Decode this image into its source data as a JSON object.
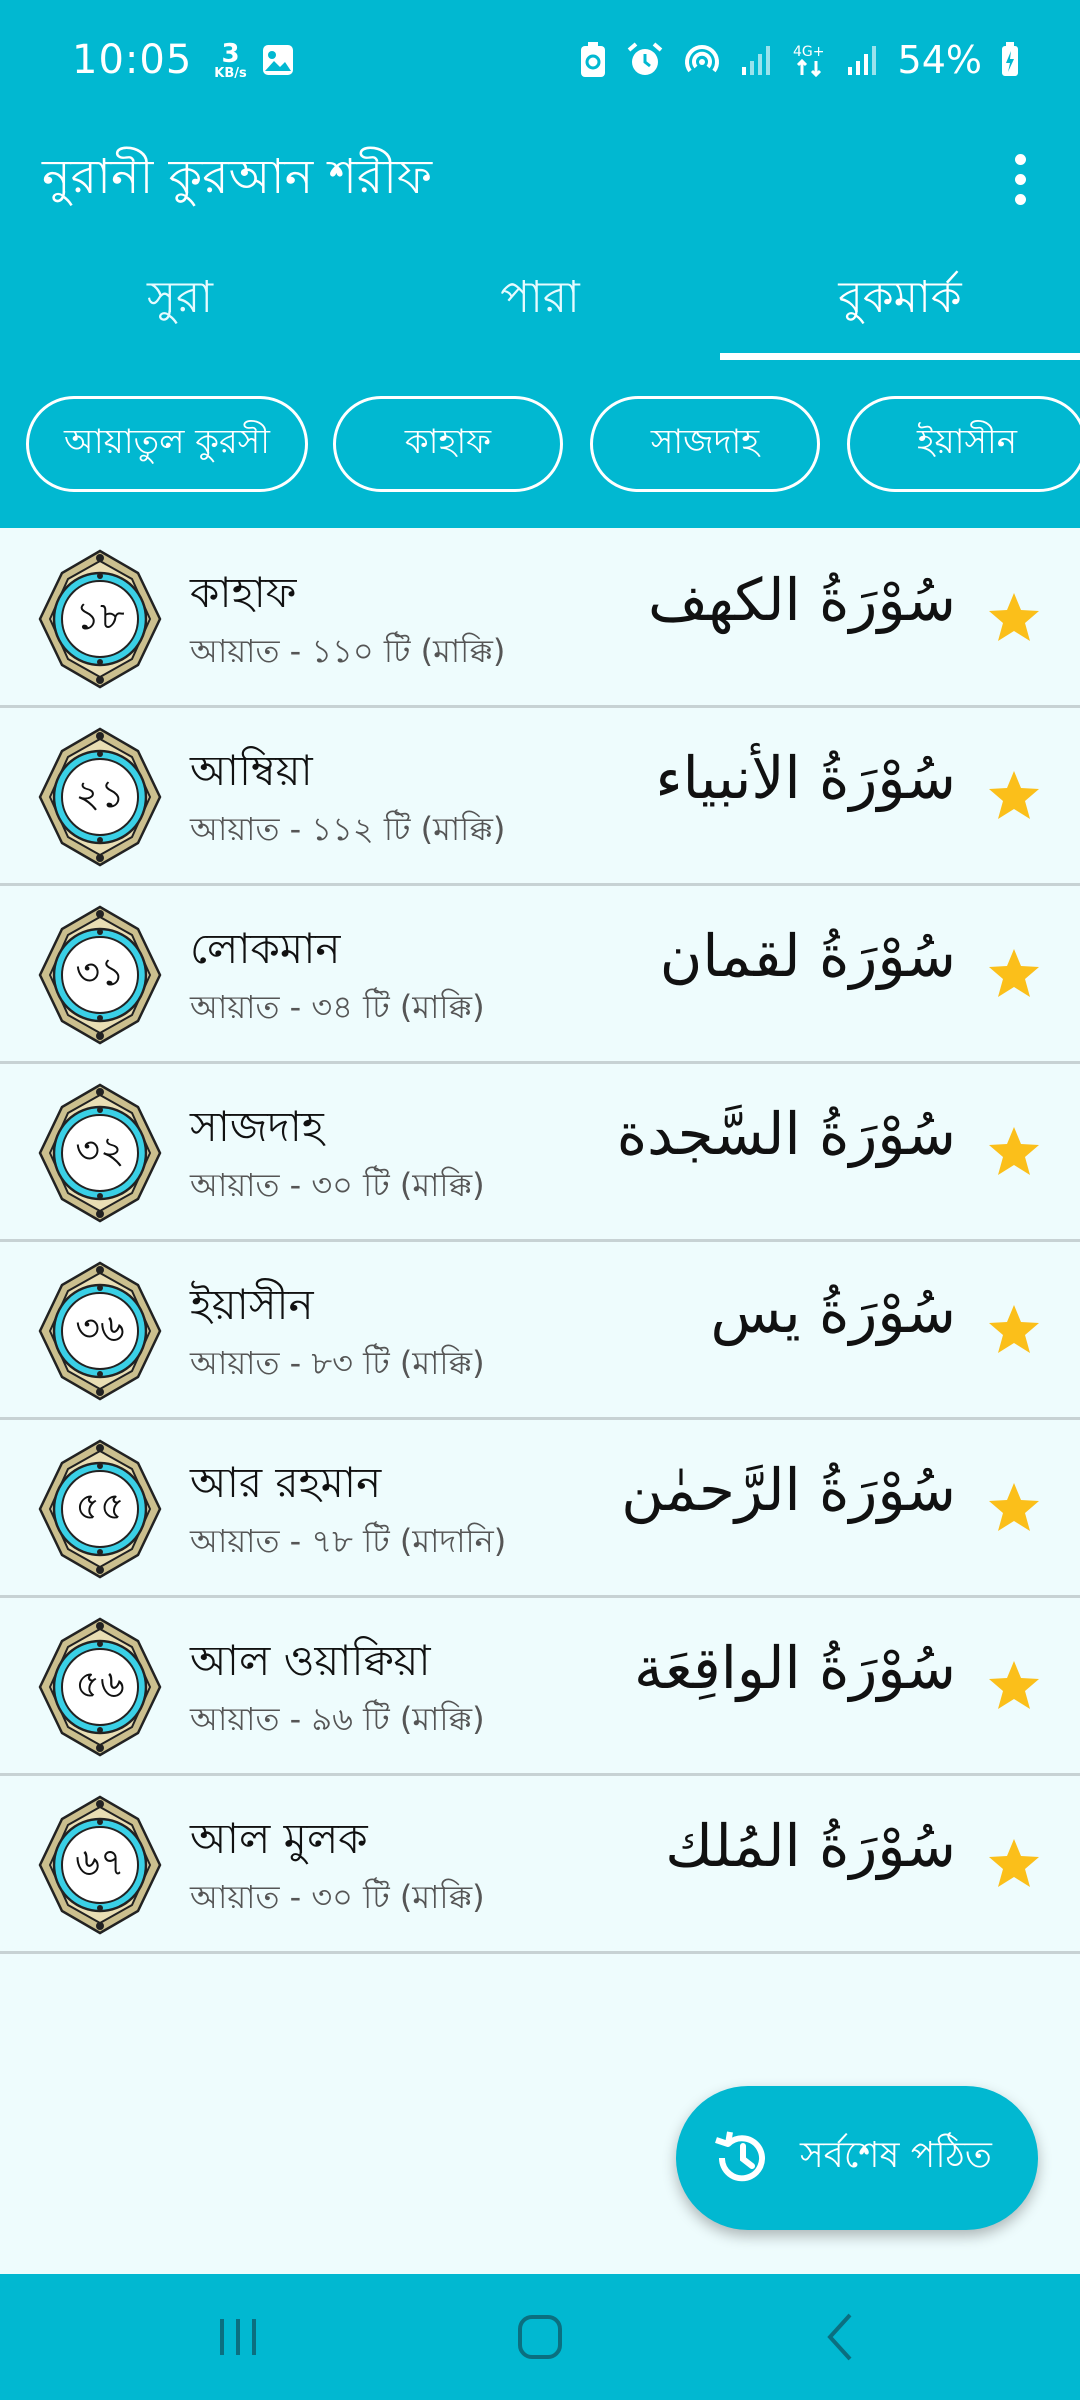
{
  "status": {
    "time": "10:05",
    "net_speed_value": "3",
    "net_speed_unit": "KB/s",
    "battery": "54%"
  },
  "app": {
    "title": "নুরানী কুরআন শরীফ",
    "menu_icon": "more-vert-icon"
  },
  "tabs": [
    {
      "label": "সুরা",
      "active": false
    },
    {
      "label": "পারা",
      "active": false
    },
    {
      "label": "বুকমার্ক",
      "active": true
    }
  ],
  "chips": [
    {
      "label": "আয়াতুল কুরসী"
    },
    {
      "label": "কাহাফ"
    },
    {
      "label": "সাজদাহ"
    },
    {
      "label": "ইয়াসীন"
    }
  ],
  "bookmarks": [
    {
      "number": "১৮",
      "name": "কাহাফ",
      "info": "আয়াত - ১১০ টি (মাক্কি)",
      "arabic": "سُوْرَةُ الكهف",
      "starred": true
    },
    {
      "number": "২১",
      "name": "আম্বিয়া",
      "info": "আয়াত - ১১২ টি (মাক্কি)",
      "arabic": "سُوْرَةُ الأنبياء",
      "starred": true
    },
    {
      "number": "৩১",
      "name": "লোকমান",
      "info": "আয়াত - ৩৪ টি (মাক্কি)",
      "arabic": "سُوْرَةُ لقمان",
      "starred": true
    },
    {
      "number": "৩২",
      "name": "সাজদাহ",
      "info": "আয়াত - ৩০ টি (মাক্কি)",
      "arabic": "سُوْرَةُ السَّجدة",
      "starred": true
    },
    {
      "number": "৩৬",
      "name": "ইয়াসীন",
      "info": "আয়াত - ৮৩ টি (মাক্কি)",
      "arabic": "سُوْرَةُ يس",
      "starred": true
    },
    {
      "number": "৫৫",
      "name": "আর রহমান",
      "info": "আয়াত - ৭৮ টি (মাদানি)",
      "arabic": "سُوْرَةُ الرَّحمٰن",
      "starred": true
    },
    {
      "number": "৫৬",
      "name": "আল ওয়াক্বিয়া",
      "info": "আয়াত - ৯৬ টি (মাক্কি)",
      "arabic": "سُوْرَةُ الواقِعَة",
      "starred": true
    },
    {
      "number": "৬৭",
      "name": "আল মুলক",
      "info": "আয়াত - ৩০ টি (মাক্কি)",
      "arabic": "سُوْرَةُ المُلك",
      "starred": true
    }
  ],
  "fab": {
    "label": "সর্বশেষ পঠিত",
    "icon": "history-icon"
  },
  "nav": {
    "recents_icon": "recents-icon",
    "home_icon": "home-icon",
    "back_icon": "back-icon"
  },
  "colors": {
    "primary": "#01b8d1",
    "list_bg": "#eefcfd",
    "star": "#fbbf1a"
  }
}
